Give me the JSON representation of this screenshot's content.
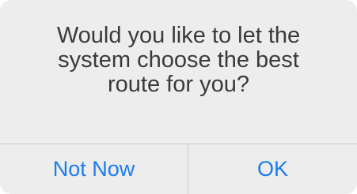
{
  "dialog": {
    "message": "Would you like to let the system choose the best route for you?",
    "buttons": {
      "not_now_label": "Not Now",
      "ok_label": "OK"
    }
  },
  "colors": {
    "panel_background": "#ededed",
    "text": "#3a3a3a",
    "button_text": "#1a7cf3",
    "divider": "#c9c9c9"
  }
}
